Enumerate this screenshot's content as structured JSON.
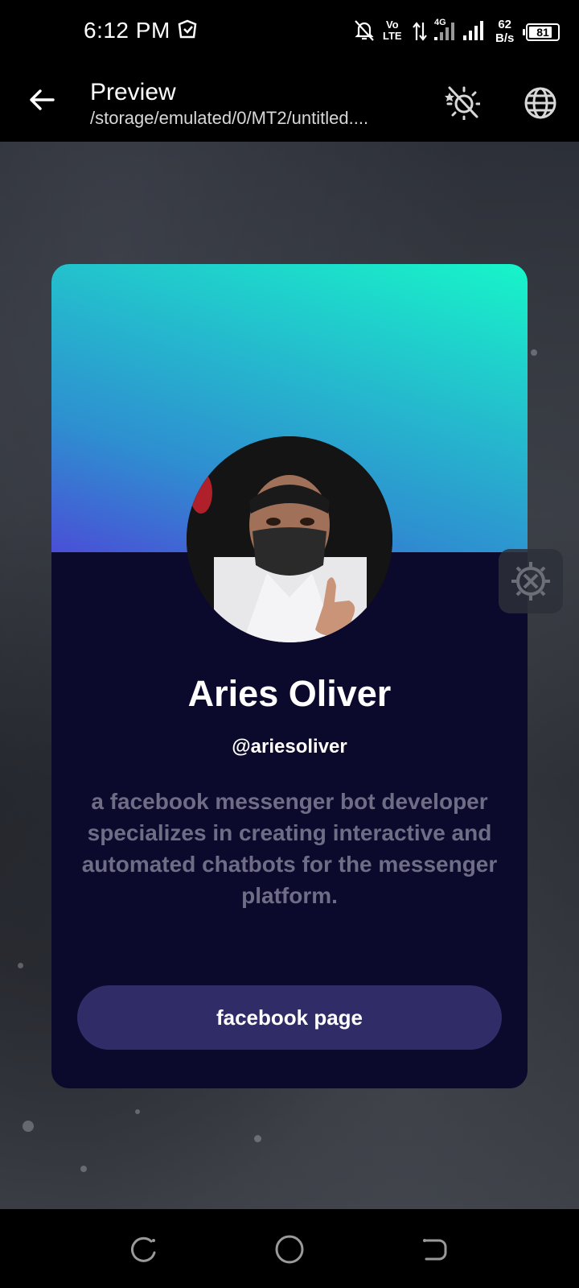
{
  "status_bar": {
    "time": "6:12 PM",
    "volte": [
      "Vo",
      "LTE"
    ],
    "network_type": "4G",
    "net_speed": [
      "62",
      "B/s"
    ],
    "battery_level": "81",
    "icons": [
      "notification-icon",
      "mute-icon",
      "data-arrows-icon",
      "signal-icon",
      "signal-icon"
    ]
  },
  "app_bar": {
    "title": "Preview",
    "subtitle": "/storage/emulated/0/MT2/untitled....",
    "icons": [
      "back-arrow-icon",
      "theme-toggle-icon",
      "globe-icon"
    ]
  },
  "card": {
    "name": "Aries Oliver",
    "handle": "@ariesoliver",
    "bio": "a facebook messenger bot developer specializes in creating interactive and automated chatbots for the messenger platform.",
    "button_label": "facebook page",
    "colors": {
      "header_gradient_start": "#4a4fd6",
      "header_gradient_end": "#17f5c9",
      "body": "#0c0a2c",
      "button": "#302c68",
      "bio_text": "#6f6d86"
    }
  },
  "floating_tool": {
    "icon": "settings-tools-icon"
  },
  "nav_bar": {
    "icons": [
      "recents-icon",
      "home-icon",
      "back-icon"
    ]
  }
}
